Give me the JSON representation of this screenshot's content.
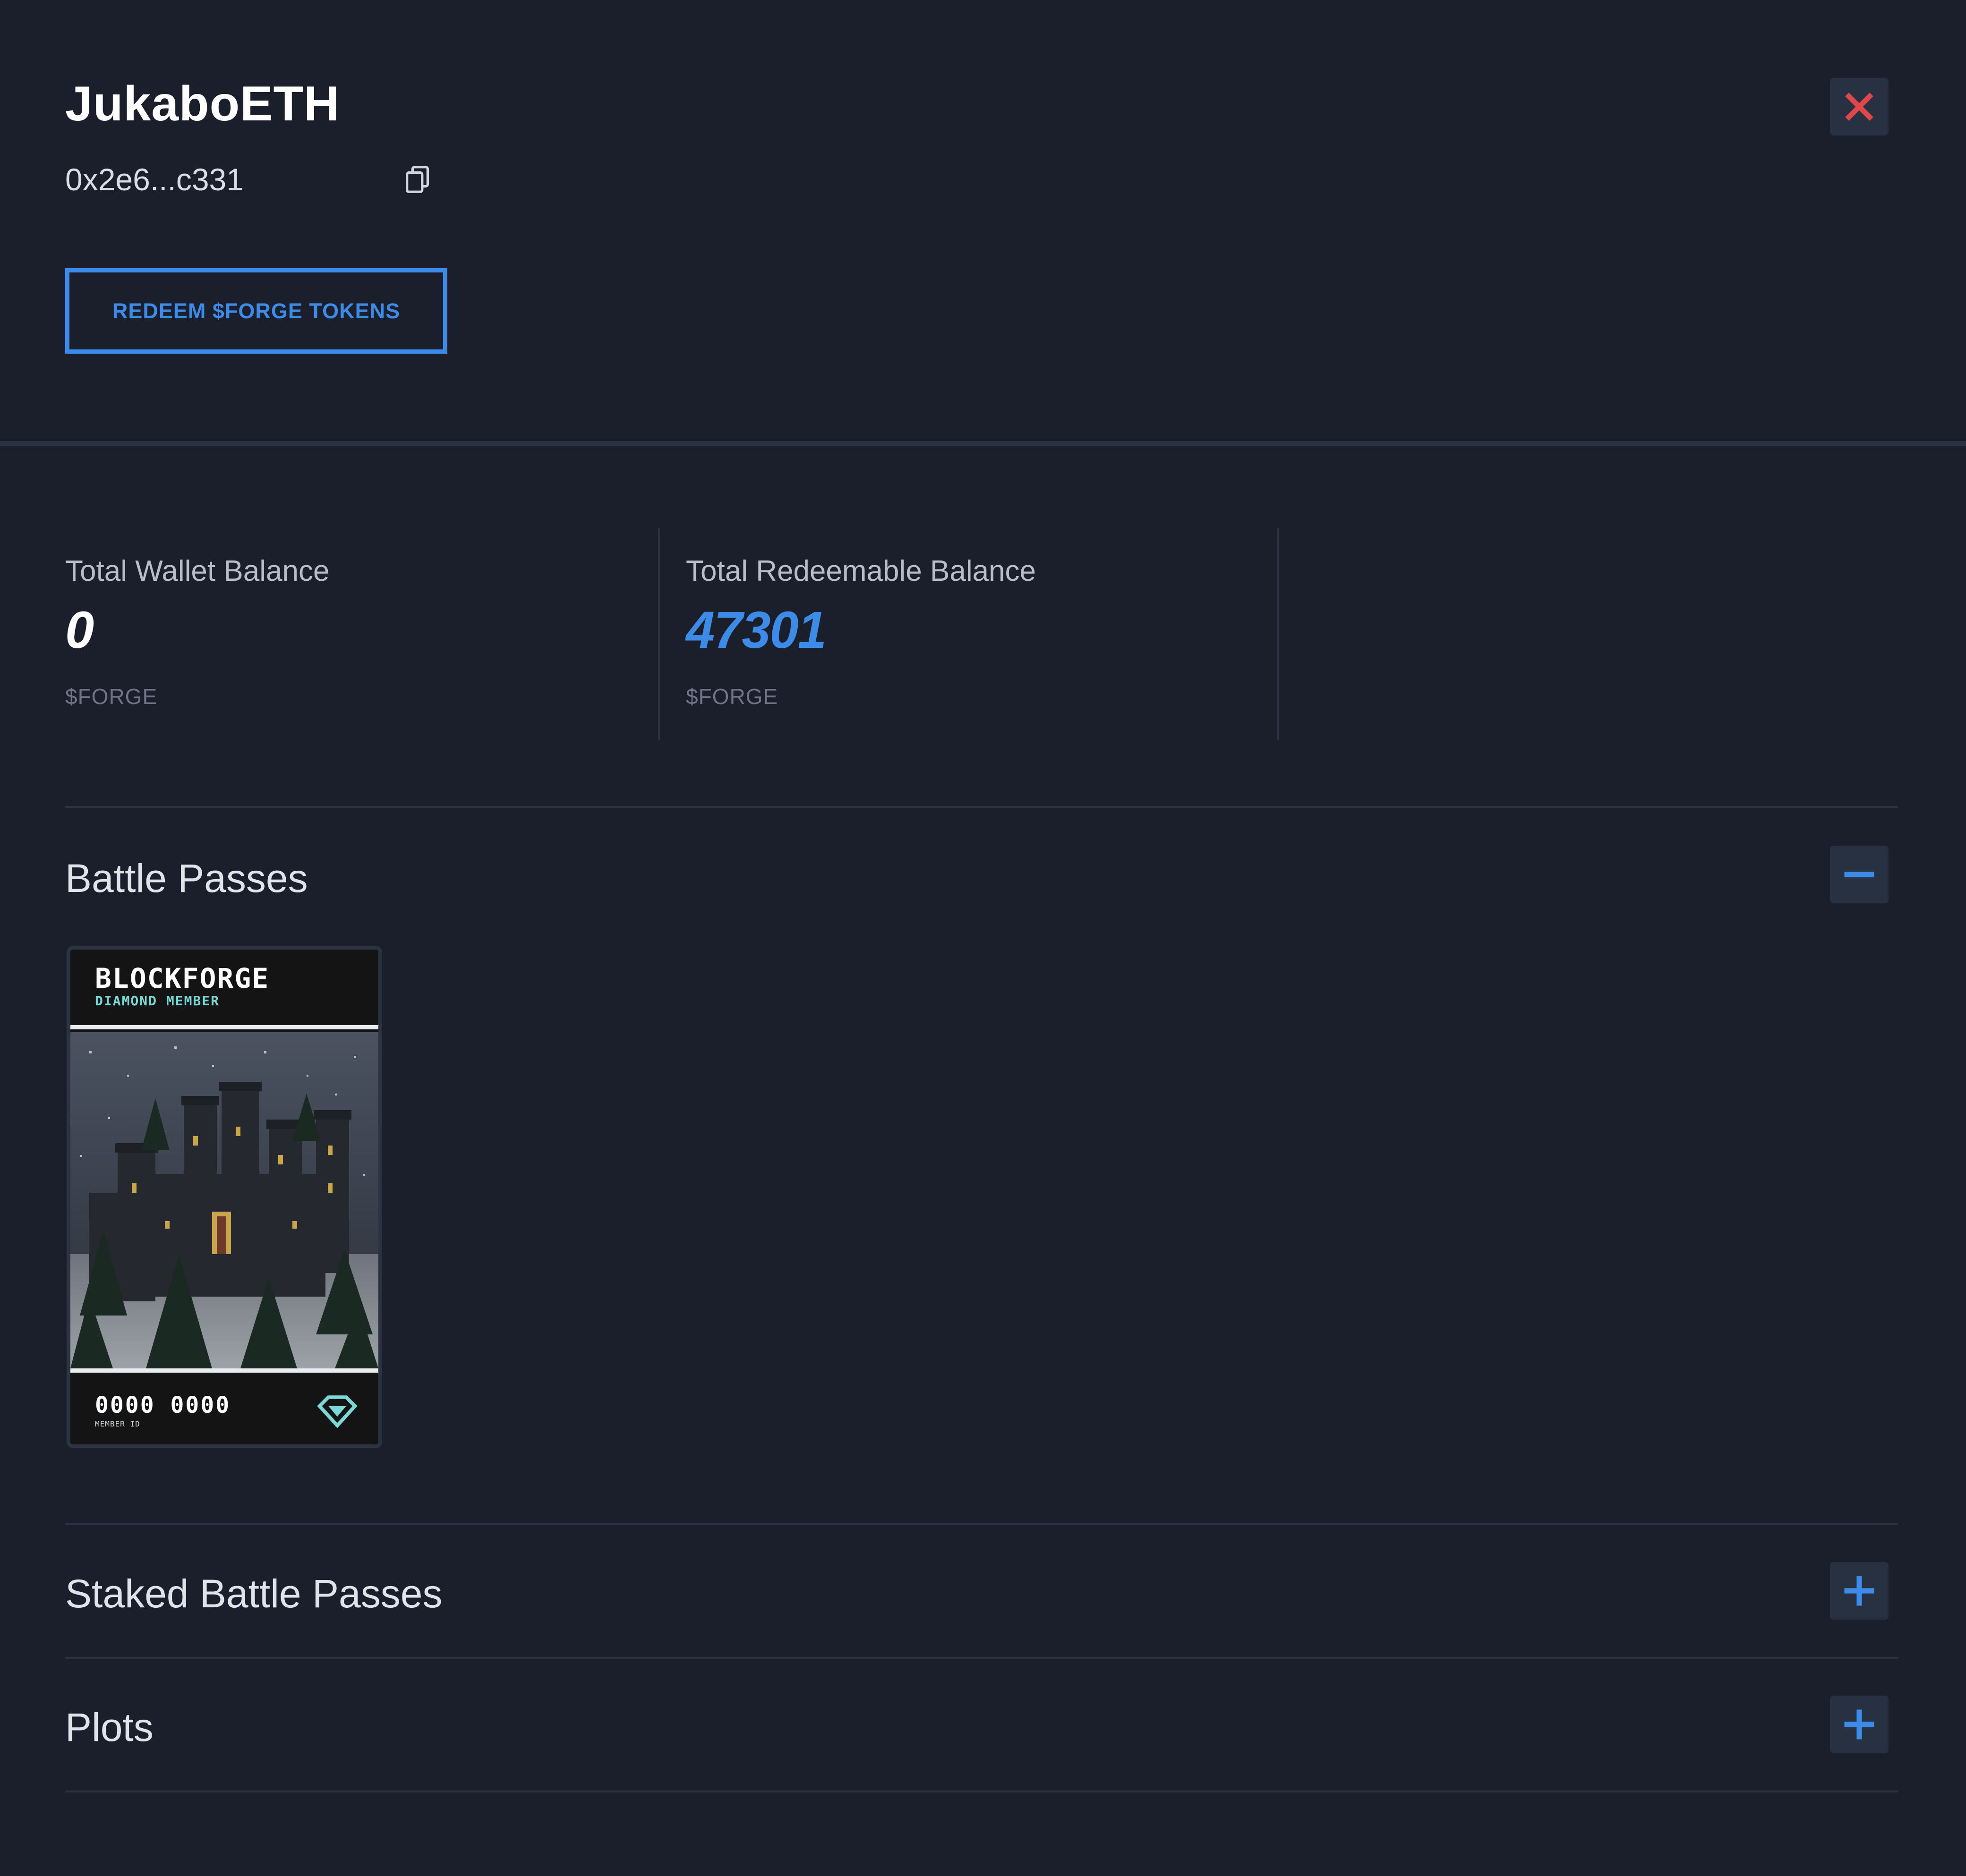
{
  "profile": {
    "name": "JukaboETH",
    "address": "0x2e6...c331",
    "redeem_label": "REDEEM $FORGE TOKENS"
  },
  "balances": [
    {
      "label": "Total Wallet Balance",
      "value": "0",
      "unit": "$FORGE"
    },
    {
      "label": "Total Redeemable Balance",
      "value": "47301",
      "unit": "$FORGE"
    }
  ],
  "sections": {
    "battle_passes": {
      "title": "Battle Passes",
      "state": "expanded",
      "toggle_icon": "minus-icon"
    },
    "staked_battle_passes": {
      "title": "Staked Battle Passes",
      "state": "collapsed",
      "toggle_icon": "plus-icon"
    },
    "plots": {
      "title": "Plots",
      "state": "collapsed",
      "toggle_icon": "plus-icon"
    }
  },
  "battle_pass_card": {
    "brand": "BLOCKFORGE",
    "tier": "DIAMOND MEMBER",
    "member_id": "0000 0000",
    "member_id_label": "MEMBER ID"
  },
  "colors": {
    "background": "#1a1f2b",
    "accent": "#3d8be8",
    "close": "#e0474c",
    "button_bg": "#283141",
    "divider": "#2a3140"
  }
}
